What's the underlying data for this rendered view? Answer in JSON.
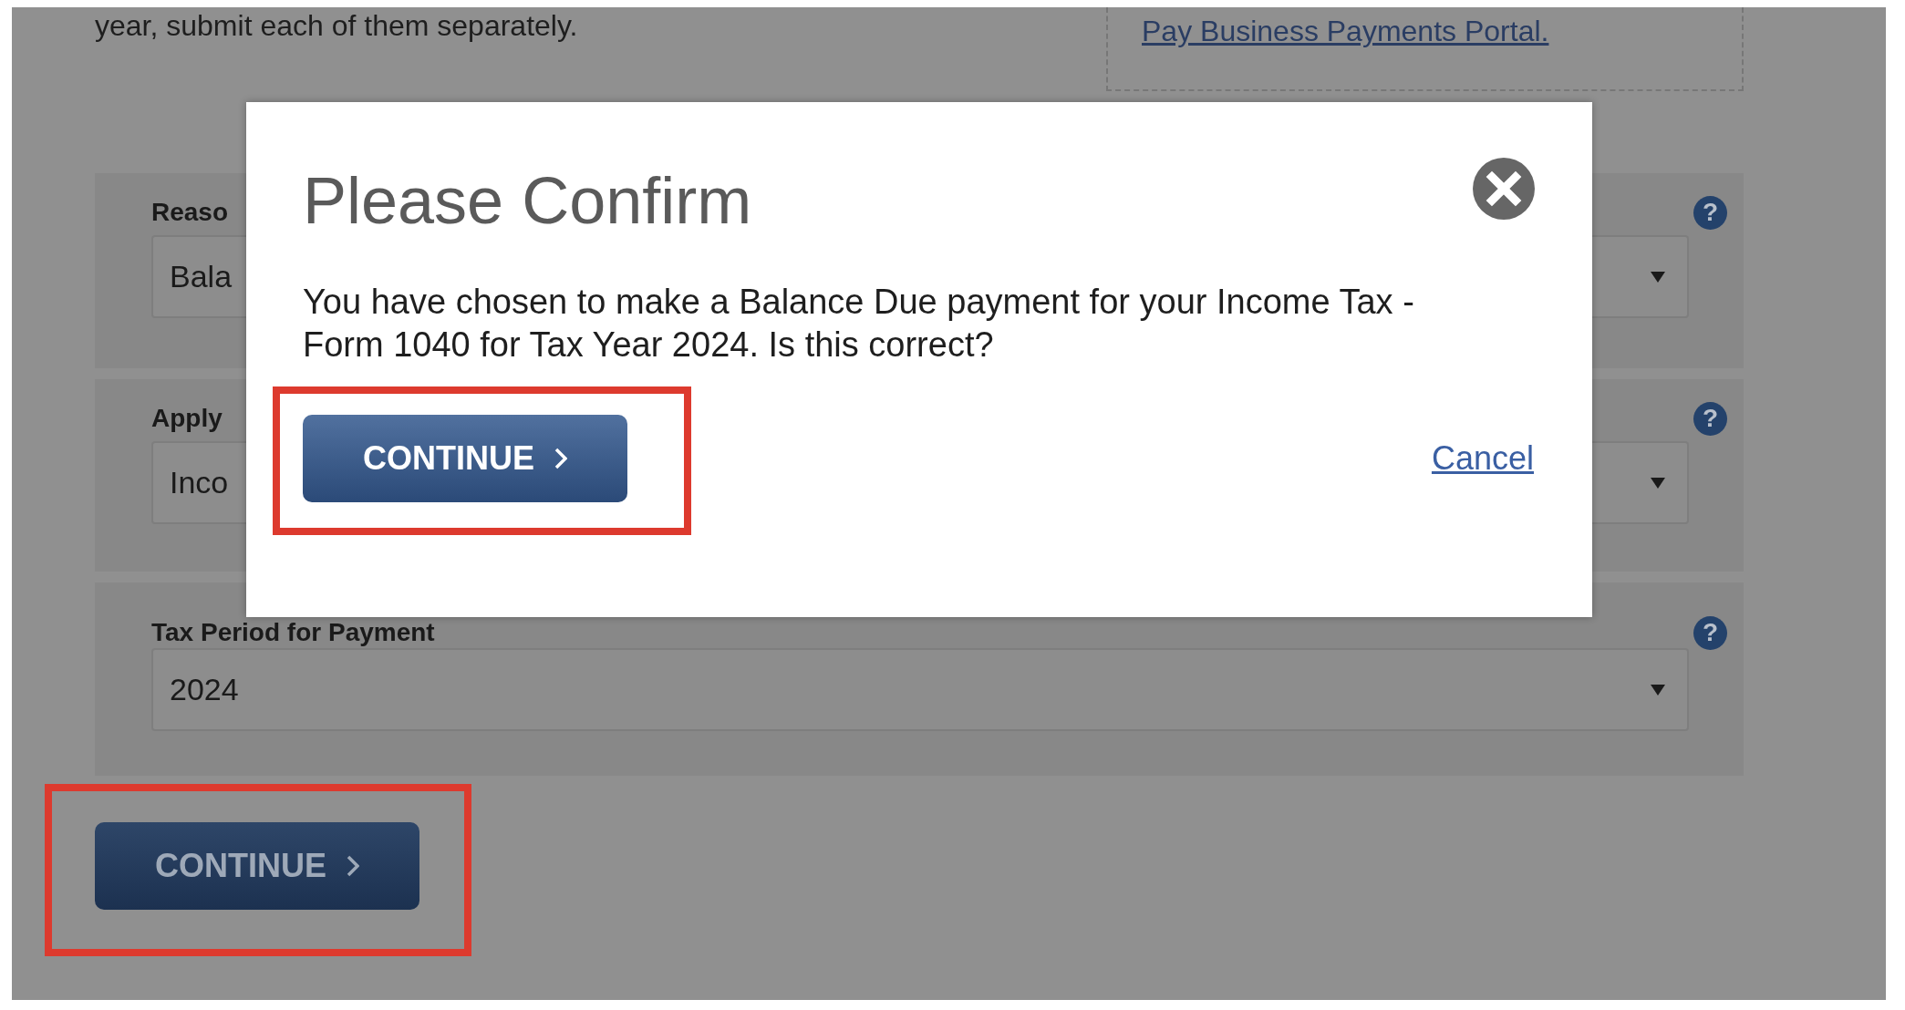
{
  "page": {
    "intro_text": "year, submit each of them separately.",
    "portal_link": "Pay Business Payments Portal.",
    "fields": [
      {
        "label": "Reaso",
        "value": "Bala",
        "help_icon": "?"
      },
      {
        "label": "Apply",
        "value": "Inco",
        "help_icon": "?"
      },
      {
        "label": "Tax Period for Payment",
        "value": "2024",
        "help_icon": "?"
      }
    ],
    "continue_button": {
      "label": "CONTINUE",
      "highlighted": true
    }
  },
  "dialog": {
    "title": "Please Confirm",
    "message": "You have chosen to make a Balance Due payment for your Income Tax - Form 1040 for Tax Year 2024. Is this correct?",
    "continue_button": {
      "label": "CONTINUE",
      "highlighted": true
    },
    "cancel_link": "Cancel"
  }
}
